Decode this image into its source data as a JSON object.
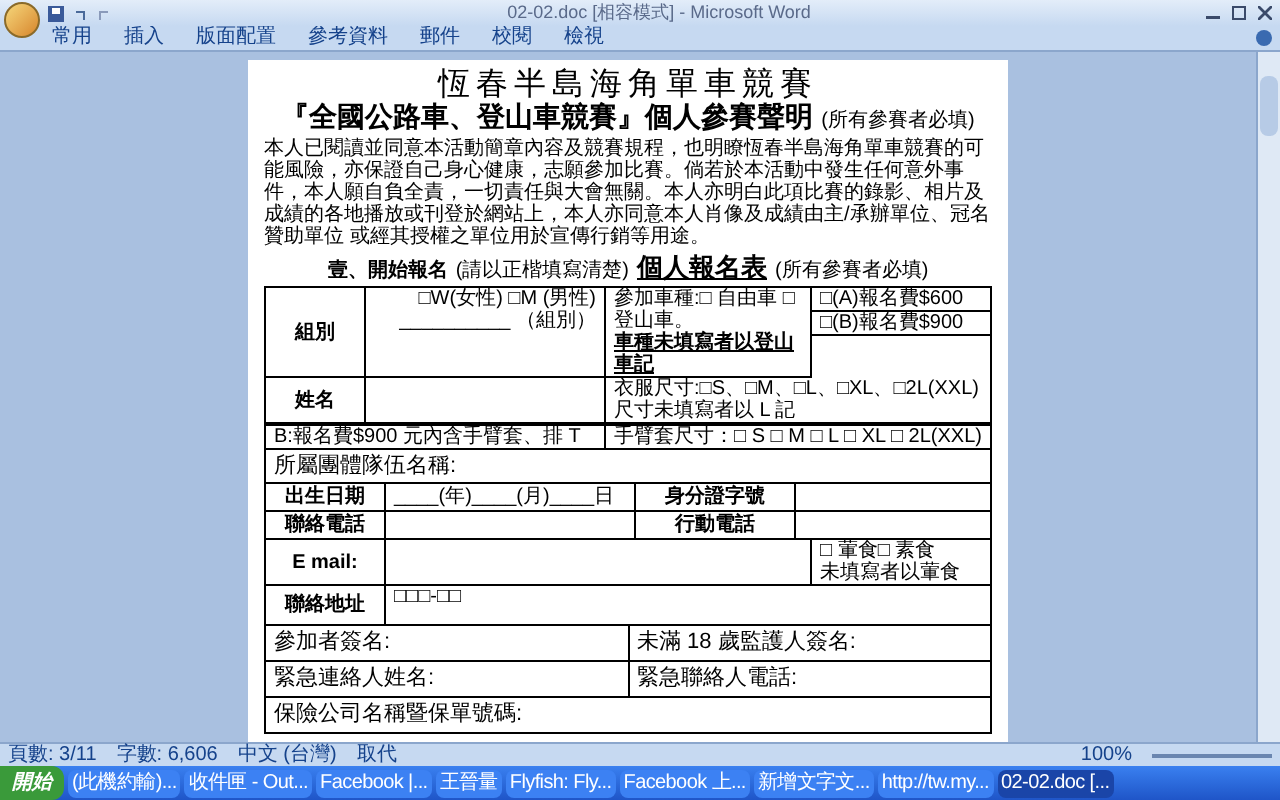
{
  "window": {
    "title": "02-02.doc [相容模式] - Microsoft Word"
  },
  "ribbon_tabs": [
    {
      "label": "常用",
      "selected": false
    },
    {
      "label": "插入",
      "selected": false
    },
    {
      "label": "版面配置",
      "selected": false
    },
    {
      "label": "參考資料",
      "selected": false
    },
    {
      "label": "郵件",
      "selected": false
    },
    {
      "label": "校閱",
      "selected": false
    },
    {
      "label": "檢視",
      "selected": false
    }
  ],
  "document": {
    "title": "恆春半島海角單車競賽",
    "subtitle": "『全國公路車、登山車競賽』個人參賽聲明",
    "subtitle_note": "(所有參賽者必填)",
    "statement": "本人已閱讀並同意本活動簡章內容及競賽規程，也明瞭恆春半島海角單車競賽的可能風險，亦保證自己身心健康，志願參加比賽。倘若於本活動中發生任何意外事件，本人願自負全責，一切責任與大會無關。本人亦明白此項比賽的錄影、相片及成績的各地播放或刊登於網站上，本人亦同意本人肖像及成績由主/承辦單位、冠名贊助單位 或經其授權之單位用於宣傳行銷等用途。",
    "section_heading": "壹、開始報名",
    "section_hint": "(請以正楷填寫清楚)",
    "form_title": "個人報名表",
    "form_note": "(所有參賽者必填)",
    "form": {
      "group_label": "組別",
      "gender_options": "□W(女性) □M (男性)",
      "group_blank": "__________ （組別）",
      "bike_type": "參加車種:□ 自由車 □ 登山車。",
      "bike_note": "車種未填寫者以登山車記",
      "fee_a": "□(A)報名費$600",
      "fee_b": "□(B)報名費$900",
      "name_label": "姓名",
      "shirt_size": "衣服尺寸:□S、□M、□L、□XL、□2L(XXL)",
      "shirt_note": "尺寸未填寫者以 L 記",
      "fee_b_note": "B:報名費$900 元內含手臂套、排 T",
      "sleeve_size": "手臂套尺寸：□ S □ M □ L □ XL □ 2L(XXL)",
      "team": "所屬團體隊伍名稱:",
      "birth_label": "出生日期",
      "birth_blank": "____(年)____(月)____日",
      "id_label": "身分證字號",
      "phone_label": "聯絡電話",
      "mobile_label": "行動電話",
      "email_label": "E mail:",
      "meal": "□ 葷食□ 素食",
      "meal_note": "未填寫者以葷食",
      "address_label": "聯絡地址",
      "postcode": "□□□-□□",
      "signer": "參加者簽名:",
      "guardian": "未滿 18 歲監護人簽名:",
      "emergency_name": "緊急連絡人姓名:",
      "emergency_phone": "緊急聯絡人電話:",
      "insurance": "保險公司名稱暨保單號碼:"
    }
  },
  "status_bar": {
    "page": "頁數: 3/11",
    "words": "字數: 6,606",
    "language": "中文 (台灣)",
    "mode": "取代",
    "zoom": "100%"
  },
  "taskbar": {
    "start": "開始",
    "tasks": [
      {
        "label": "(此機約輸)...",
        "selected": false
      },
      {
        "label": "收件匣 - Out...",
        "selected": false
      },
      {
        "label": "Facebook |...",
        "selected": false
      },
      {
        "label": "王晉量",
        "selected": false
      },
      {
        "label": "Flyfish: Fly...",
        "selected": false
      },
      {
        "label": "Facebook 上...",
        "selected": false
      },
      {
        "label": "新增文字文...",
        "selected": false
      },
      {
        "label": "http://tw.my...",
        "selected": false
      },
      {
        "label": "02-02.doc [...",
        "selected": true
      }
    ]
  }
}
